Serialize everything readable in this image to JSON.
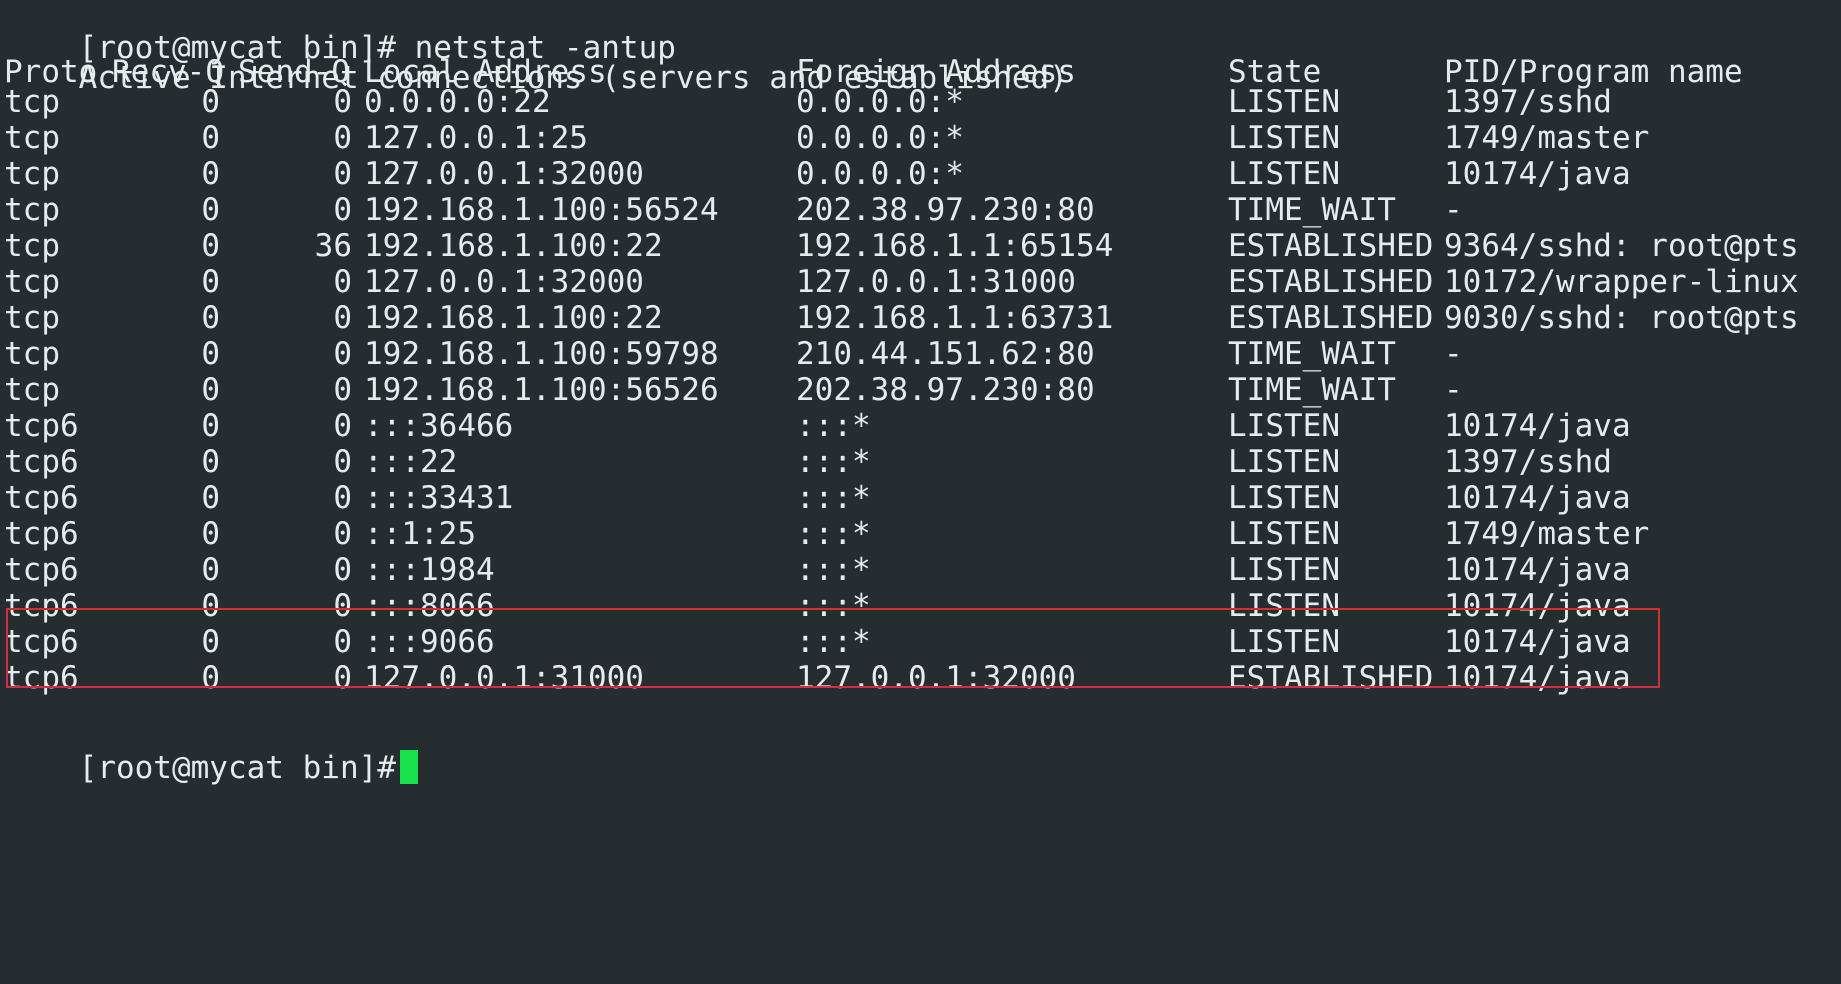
{
  "terminal": {
    "command_prompt": "[root@mycat bin]# netstat -antup",
    "summary": "Active Internet connections (servers and established)",
    "headers": {
      "proto": "Proto",
      "recv": "Recv-Q",
      "send": "Send-Q",
      "local": "Local Address",
      "foreign": "Foreign Address",
      "state": "State",
      "pid": "PID/Program name"
    },
    "rows": [
      {
        "proto": "tcp",
        "recv": "0",
        "send": "0",
        "local": "0.0.0.0:22",
        "foreign": "0.0.0.0:*",
        "state": "LISTEN",
        "pid": "1397/sshd"
      },
      {
        "proto": "tcp",
        "recv": "0",
        "send": "0",
        "local": "127.0.0.1:25",
        "foreign": "0.0.0.0:*",
        "state": "LISTEN",
        "pid": "1749/master"
      },
      {
        "proto": "tcp",
        "recv": "0",
        "send": "0",
        "local": "127.0.0.1:32000",
        "foreign": "0.0.0.0:*",
        "state": "LISTEN",
        "pid": "10174/java"
      },
      {
        "proto": "tcp",
        "recv": "0",
        "send": "0",
        "local": "192.168.1.100:56524",
        "foreign": "202.38.97.230:80",
        "state": "TIME_WAIT",
        "pid": "-"
      },
      {
        "proto": "tcp",
        "recv": "0",
        "send": "36",
        "local": "192.168.1.100:22",
        "foreign": "192.168.1.1:65154",
        "state": "ESTABLISHED",
        "pid": "9364/sshd: root@pts"
      },
      {
        "proto": "tcp",
        "recv": "0",
        "send": "0",
        "local": "127.0.0.1:32000",
        "foreign": "127.0.0.1:31000",
        "state": "ESTABLISHED",
        "pid": "10172/wrapper-linux"
      },
      {
        "proto": "tcp",
        "recv": "0",
        "send": "0",
        "local": "192.168.1.100:22",
        "foreign": "192.168.1.1:63731",
        "state": "ESTABLISHED",
        "pid": "9030/sshd: root@pts"
      },
      {
        "proto": "tcp",
        "recv": "0",
        "send": "0",
        "local": "192.168.1.100:59798",
        "foreign": "210.44.151.62:80",
        "state": "TIME_WAIT",
        "pid": "-"
      },
      {
        "proto": "tcp",
        "recv": "0",
        "send": "0",
        "local": "192.168.1.100:56526",
        "foreign": "202.38.97.230:80",
        "state": "TIME_WAIT",
        "pid": "-"
      },
      {
        "proto": "tcp6",
        "recv": "0",
        "send": "0",
        "local": ":::36466",
        "foreign": ":::*",
        "state": "LISTEN",
        "pid": "10174/java"
      },
      {
        "proto": "tcp6",
        "recv": "0",
        "send": "0",
        "local": ":::22",
        "foreign": ":::*",
        "state": "LISTEN",
        "pid": "1397/sshd"
      },
      {
        "proto": "tcp6",
        "recv": "0",
        "send": "0",
        "local": ":::33431",
        "foreign": ":::*",
        "state": "LISTEN",
        "pid": "10174/java"
      },
      {
        "proto": "tcp6",
        "recv": "0",
        "send": "0",
        "local": "::1:25",
        "foreign": ":::*",
        "state": "LISTEN",
        "pid": "1749/master"
      },
      {
        "proto": "tcp6",
        "recv": "0",
        "send": "0",
        "local": ":::1984",
        "foreign": ":::*",
        "state": "LISTEN",
        "pid": "10174/java"
      },
      {
        "proto": "tcp6",
        "recv": "0",
        "send": "0",
        "local": ":::8066",
        "foreign": ":::*",
        "state": "LISTEN",
        "pid": "10174/java"
      },
      {
        "proto": "tcp6",
        "recv": "0",
        "send": "0",
        "local": ":::9066",
        "foreign": ":::*",
        "state": "LISTEN",
        "pid": "10174/java"
      },
      {
        "proto": "tcp6",
        "recv": "0",
        "send": "0",
        "local": "127.0.0.1:31000",
        "foreign": "127.0.0.1:32000",
        "state": "ESTABLISHED",
        "pid": "10174/java"
      }
    ],
    "final_prompt": "[root@mycat bin]#"
  },
  "colors": {
    "background": "#262d31",
    "text": "#e6ebee",
    "highlight_border": "#d32f3a",
    "cursor": "#19e34a"
  }
}
